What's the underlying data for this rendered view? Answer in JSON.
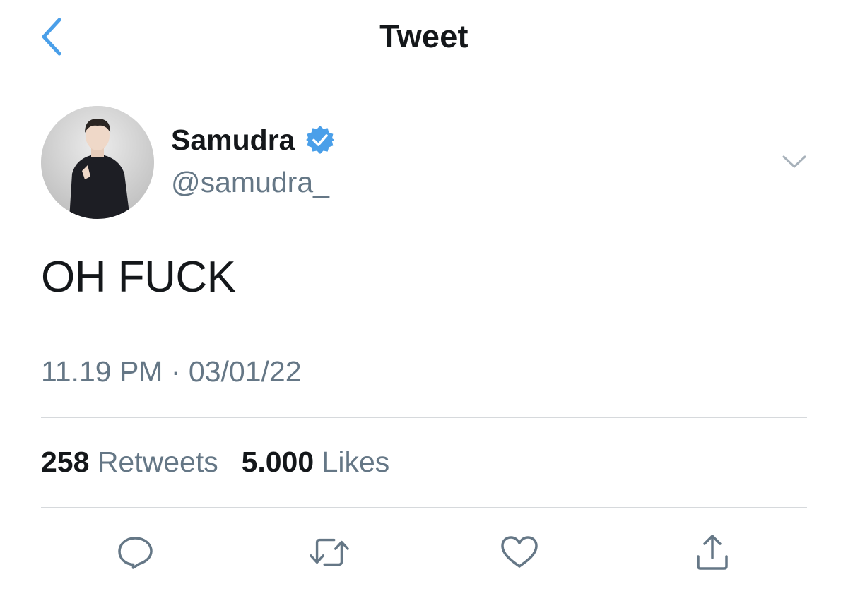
{
  "header": {
    "title": "Tweet",
    "back_icon": "chevron-left-icon",
    "accent_color": "#4a9fe9"
  },
  "tweet": {
    "author": {
      "display_name": "Samudra",
      "handle": "@samudra_",
      "verified": true,
      "verified_color": "#4a9fe9"
    },
    "text": "OH FUCK",
    "time": "11.19 PM",
    "separator": "·",
    "date": "03/01/22",
    "stats": {
      "retweets_count": "258",
      "retweets_label": "Retweets",
      "likes_count": "5.000",
      "likes_label": "Likes"
    },
    "actions": [
      "reply-icon",
      "retweet-icon",
      "like-icon",
      "share-icon"
    ],
    "text_color": "#14171a",
    "secondary_color": "#657786"
  }
}
